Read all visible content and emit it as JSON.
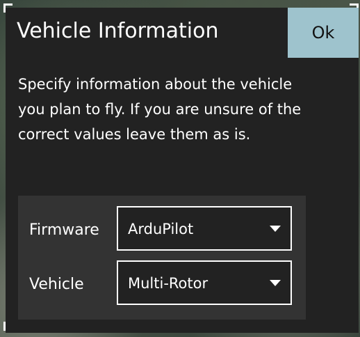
{
  "dialog": {
    "title": "Vehicle Information",
    "ok_label": "Ok",
    "description": "Specify information about the vehicle you plan to fly. If you are unsure of the correct values leave them as is."
  },
  "fields": {
    "firmware": {
      "label": "Firmware",
      "value": "ArduPilot"
    },
    "vehicle": {
      "label": "Vehicle",
      "value": "Multi-Rotor"
    }
  },
  "icons": {
    "dropdown": "chevron-down-icon",
    "corner": "frame-corner-icon"
  },
  "colors": {
    "dialog_background": "#222222",
    "panel_background": "#333333",
    "ok_button": "#9ec3cd",
    "text": "#ffffff"
  }
}
